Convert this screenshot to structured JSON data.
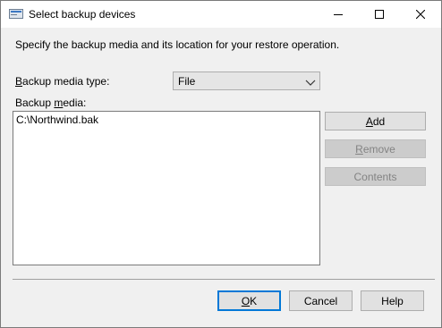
{
  "window": {
    "title": "Select backup devices",
    "controls": [
      "minimize",
      "maximize",
      "close"
    ]
  },
  "description": "Specify the backup media and its location for your restore operation.",
  "backup_media_type": {
    "label_prefix": "B",
    "label_rest": "ackup media type:",
    "selected": "File"
  },
  "backup_media": {
    "label_prefix": "Backup ",
    "label_accel": "m",
    "label_rest": "edia:",
    "items": [
      "C:\\Northwind.bak"
    ]
  },
  "side_buttons": {
    "add": {
      "accel": "A",
      "rest": "dd",
      "enabled": true
    },
    "remove": {
      "accel": "R",
      "rest": "emove",
      "enabled": false
    },
    "contents": {
      "accel": "",
      "rest": "Contents",
      "enabled": false
    }
  },
  "footer_buttons": {
    "ok": {
      "accel": "O",
      "rest": "K"
    },
    "cancel": "Cancel",
    "help": "Help"
  },
  "colors": {
    "dialog_bg": "#f0f0f0",
    "default_button_border": "#0078d7",
    "disabled_text": "#838383"
  }
}
